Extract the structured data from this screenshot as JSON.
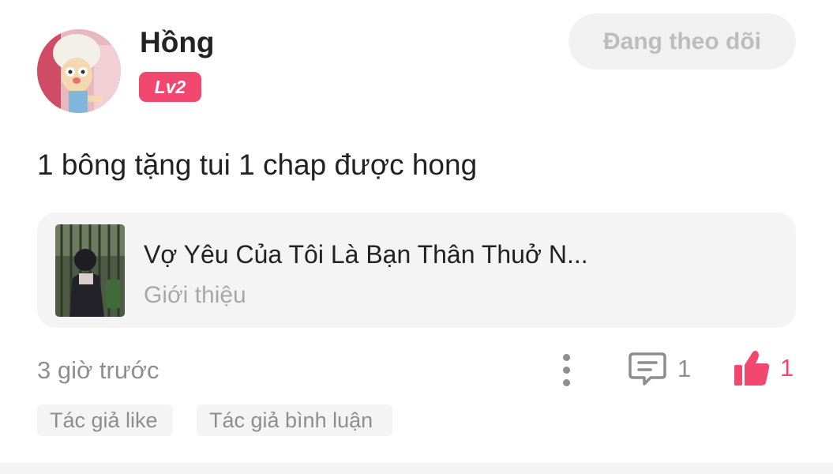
{
  "user": {
    "name": "Hồng",
    "level": "Lv2",
    "follow_label": "Đang theo dõi"
  },
  "comment": {
    "text": "1 bông tặng tui 1 chap được hong",
    "timestamp": "3 giờ trước",
    "reply_count": "1",
    "like_count": "1"
  },
  "book": {
    "title": "Vợ Yêu Của Tôi Là Bạn Thân Thuở N...",
    "subtitle": "Giới thiệu"
  },
  "tags": [
    "Tác giả like",
    "Tác giả bình luận"
  ],
  "colors": {
    "accent": "#f2476f",
    "muted_text": "#8e8e8e",
    "card_bg": "#f4f4f4"
  },
  "icons": {
    "more": "more-vertical-icon",
    "comment": "comment-icon",
    "like": "thumbs-up-icon"
  }
}
